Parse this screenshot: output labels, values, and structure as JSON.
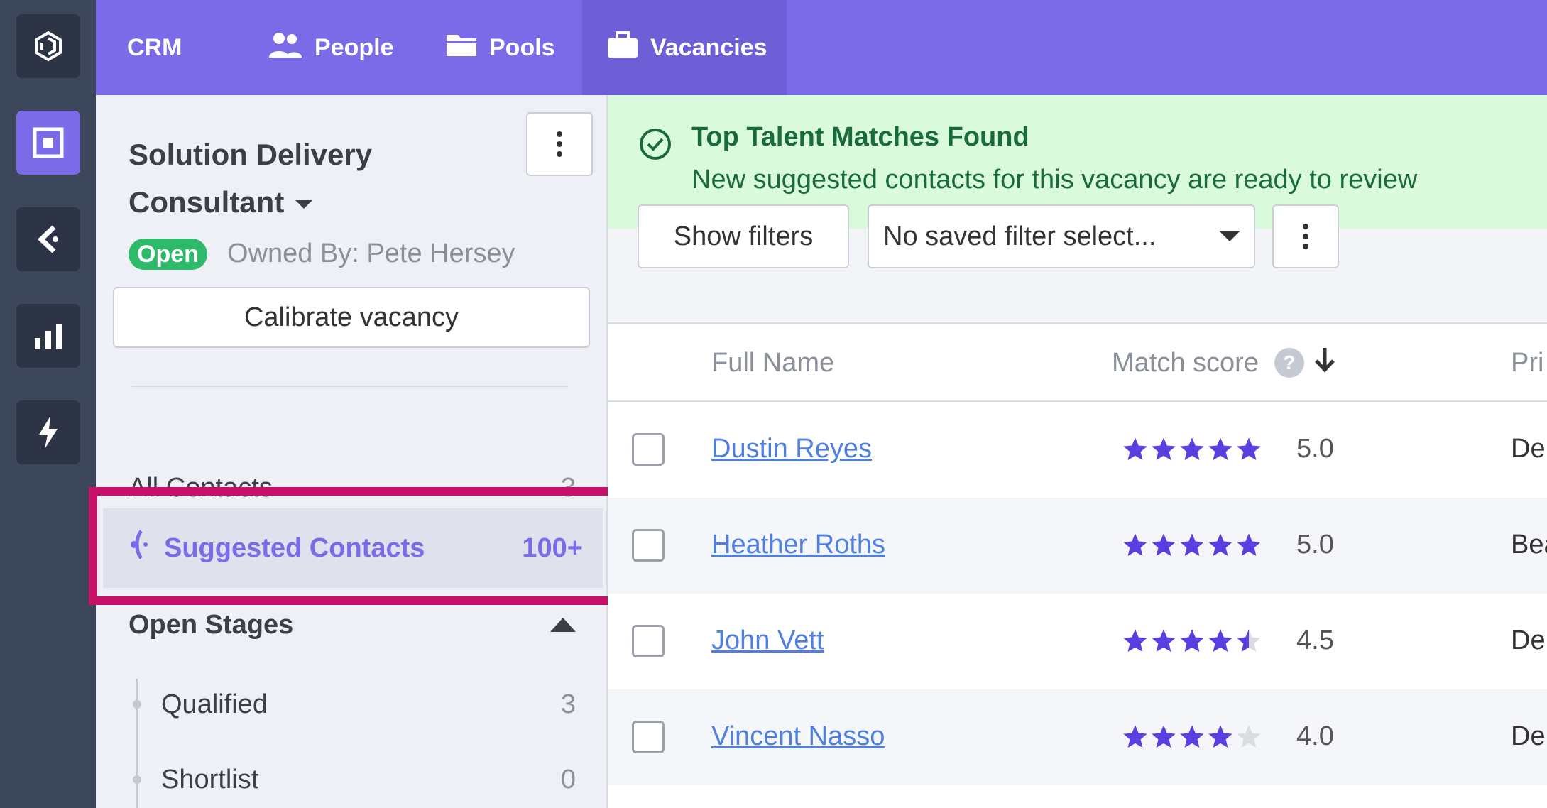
{
  "nav": {
    "app": "CRM",
    "items": [
      {
        "label": "People",
        "icon": "people-icon"
      },
      {
        "label": "Pools",
        "icon": "folder-icon"
      },
      {
        "label": "Vacancies",
        "icon": "briefcase-icon"
      }
    ],
    "active": "Vacancies",
    "accent": "#7b6be8"
  },
  "rail": {
    "icons": [
      "logo-icon",
      "vacancy-square-icon",
      "back-arrow-icon",
      "bar-chart-icon",
      "lightning-icon"
    ]
  },
  "vacancy": {
    "title_line1": "Solution Delivery",
    "title_line2": "Consultant",
    "status": "Open",
    "owner": "Owned By: Pete Hersey",
    "calibrate_label": "Calibrate vacancy"
  },
  "sidebar": {
    "all_contacts": {
      "label": "All Contacts",
      "count": "3"
    },
    "suggested": {
      "label": "Suggested Contacts",
      "count": "100+"
    },
    "stages_title": "Open Stages",
    "stages": [
      {
        "label": "Qualified",
        "count": "3"
      },
      {
        "label": "Shortlist",
        "count": "0"
      }
    ]
  },
  "banner": {
    "title": "Top Talent Matches Found",
    "subtitle": "New suggested contacts for this vacancy are ready to review",
    "color": "#d9fbdc"
  },
  "toolbar": {
    "show_filters": "Show filters",
    "filter_select": "No saved filter select..."
  },
  "table": {
    "columns": [
      "Full Name",
      "Match score",
      "Pri"
    ],
    "help": "?",
    "rows": [
      {
        "name": "Dustin Reyes",
        "stars": 5,
        "score": "5.0",
        "extra": "Dep"
      },
      {
        "name": "Heather Roths",
        "stars": 5,
        "score": "5.0",
        "extra": "Bea"
      },
      {
        "name": "John Vett",
        "stars": 4.5,
        "score": "4.5",
        "extra": "Dep"
      },
      {
        "name": "Vincent Nasso",
        "stars": 4,
        "score": "4.0",
        "extra": "Dep"
      }
    ],
    "star_color": "#5a3ee0"
  }
}
